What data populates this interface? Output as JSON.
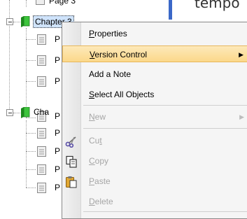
{
  "background_text": "tempo",
  "tree": {
    "top_partial_label": "Page 3",
    "chapter1_label": "Chapter 3",
    "chapter2_label": "Cha",
    "chapter1_pages": [
      "P",
      "P",
      "P",
      "P"
    ],
    "chapter2_pages": [
      "P",
      "P",
      "P",
      "P"
    ]
  },
  "menu": {
    "items": [
      {
        "pre": "",
        "u": "P",
        "post": "roperties",
        "disabled": false,
        "highlighted": false,
        "submenu": false
      },
      {
        "pre": "",
        "u": "V",
        "post": "ersion Control",
        "disabled": false,
        "highlighted": true,
        "submenu": true
      },
      {
        "pre": "Add a Note",
        "u": "",
        "post": "",
        "disabled": false,
        "highlighted": false,
        "submenu": false
      },
      {
        "pre": "",
        "u": "S",
        "post": "elect All Objects",
        "disabled": false,
        "highlighted": false,
        "submenu": false
      },
      {
        "pre": "",
        "u": "N",
        "post": "ew",
        "disabled": true,
        "highlighted": false,
        "submenu": true
      },
      {
        "pre": "Cu",
        "u": "t",
        "post": "",
        "disabled": true,
        "highlighted": false,
        "submenu": false,
        "icon": "scissors-icon"
      },
      {
        "pre": "",
        "u": "C",
        "post": "opy",
        "disabled": true,
        "highlighted": false,
        "submenu": false,
        "icon": "copy-icon"
      },
      {
        "pre": "",
        "u": "P",
        "post": "aste",
        "disabled": true,
        "highlighted": false,
        "submenu": false,
        "icon": "paste-icon"
      },
      {
        "pre": "",
        "u": "D",
        "post": "elete",
        "disabled": true,
        "highlighted": false,
        "submenu": false
      }
    ]
  },
  "colors": {
    "highlight": "#fbd88a",
    "selection": "#cfe3fb",
    "disabled_text": "#a6a6a6",
    "chapter_icon": "#2fa82f"
  }
}
